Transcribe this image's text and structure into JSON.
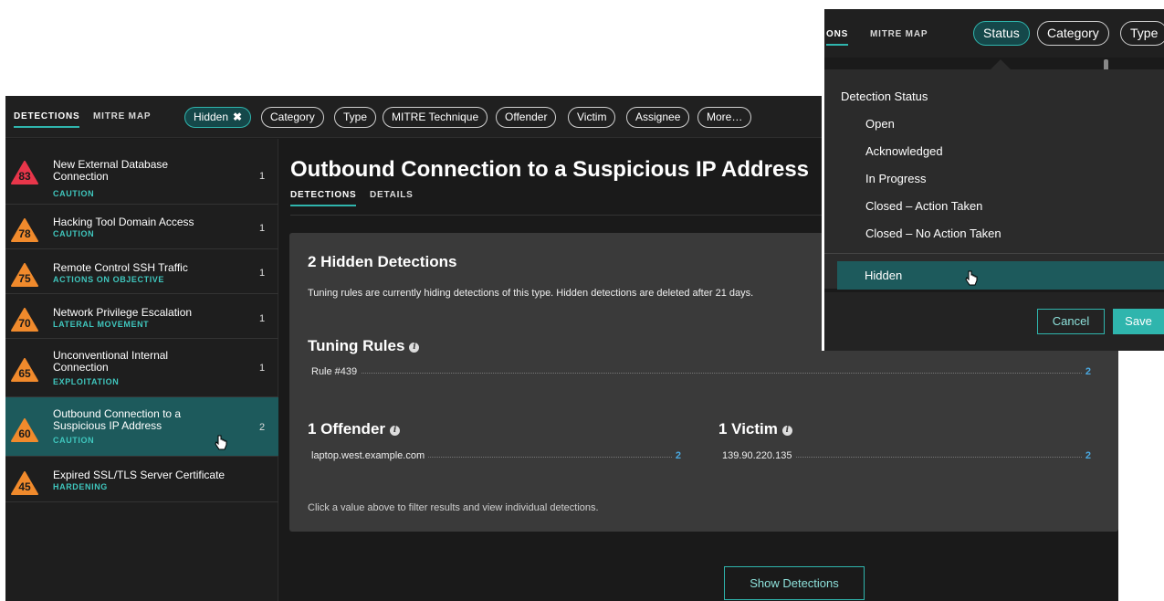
{
  "topbar": {
    "tabs": [
      {
        "label": "DETECTIONS",
        "active": true
      },
      {
        "label": "MITRE MAP",
        "active": false
      }
    ],
    "filters": [
      {
        "label": "Hidden",
        "active": true,
        "removable": true
      },
      {
        "label": "Category"
      },
      {
        "label": "Type"
      },
      {
        "label": "MITRE Technique"
      },
      {
        "label": "Offender"
      },
      {
        "label": "Victim"
      },
      {
        "label": "Assignee"
      },
      {
        "label": "More…"
      }
    ],
    "remove_icon": "✖"
  },
  "sidebar": {
    "items": [
      {
        "score": "83",
        "title": "New External Database Connection",
        "category": "CAUTION",
        "count": "1",
        "color": "#e8364a",
        "selected": false
      },
      {
        "score": "78",
        "title": "Hacking Tool Domain Access",
        "category": "CAUTION",
        "count": "1",
        "color": "#f08a2c",
        "selected": false
      },
      {
        "score": "75",
        "title": "Remote Control SSH Traffic",
        "category": "ACTIONS ON OBJECTIVE",
        "count": "1",
        "color": "#f08a2c",
        "selected": false
      },
      {
        "score": "70",
        "title": "Network Privilege Escalation",
        "category": "LATERAL MOVEMENT",
        "count": "1",
        "color": "#f08a2c",
        "selected": false
      },
      {
        "score": "65",
        "title": "Unconventional Internal Connection",
        "category": "EXPLOITATION",
        "count": "1",
        "color": "#f08a2c",
        "selected": false
      },
      {
        "score": "60",
        "title": "Outbound Connection to a Suspicious IP Address",
        "category": "CAUTION",
        "count": "2",
        "color": "#f08a2c",
        "selected": true
      },
      {
        "score": "45",
        "title": "Expired SSL/TLS Server Certificate",
        "category": "HARDENING",
        "count": "",
        "color": "#f08a2c",
        "selected": false
      }
    ]
  },
  "main": {
    "title": "Outbound Connection to a Suspicious IP Address",
    "tabs": [
      {
        "label": "DETECTIONS",
        "active": true
      },
      {
        "label": "DETAILS",
        "active": false
      }
    ],
    "panel": {
      "heading": "2 Hidden Detections",
      "description": "Tuning rules are currently hiding detections of this type. Hidden detections are deleted after 21 days.",
      "tuning_heading": "Tuning Rules",
      "tuning_rows": [
        {
          "label": "Rule #439",
          "count": "2"
        }
      ],
      "offender_heading": "1 Offender",
      "offender_rows": [
        {
          "label": "laptop.west.example.com",
          "count": "2"
        }
      ],
      "victim_heading": "1 Victim",
      "victim_rows": [
        {
          "label": "139.90.220.135",
          "count": "2"
        }
      ],
      "footer": "Click a value above to filter results and view individual detections.",
      "info_icon": "i"
    },
    "show_button": "Show Detections"
  },
  "dropdown": {
    "bar_tabs": [
      {
        "label": "ONS",
        "active": true
      },
      {
        "label": "MITRE MAP",
        "active": false
      }
    ],
    "bar_filters": [
      {
        "label": "Status",
        "active": true
      },
      {
        "label": "Category"
      },
      {
        "label": "Type"
      }
    ],
    "heading": "Detection Status",
    "options": [
      "Open",
      "Acknowledged",
      "In Progress",
      "Closed – Action Taken",
      "Closed – No Action Taken"
    ],
    "hidden_option": "Hidden",
    "cancel": "Cancel",
    "save": "Save"
  },
  "colors": {
    "accent": "#2fb5ad",
    "severe": "#e8364a",
    "warning": "#f08a2c",
    "link": "#4aa8e0"
  }
}
